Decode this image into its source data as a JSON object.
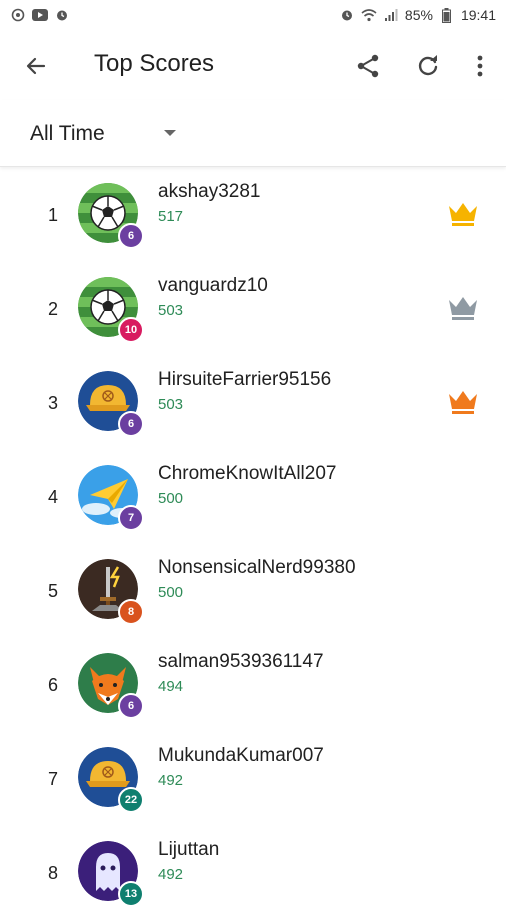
{
  "status_bar": {
    "battery": "85%",
    "time": "19:41",
    "left_icons": [
      "camera-icon",
      "youtube-icon",
      "alarm-icon"
    ],
    "right_icons": [
      "alarm-icon",
      "wifi-icon",
      "signal-icon",
      "battery-icon"
    ]
  },
  "app_bar": {
    "title": "Top Scores",
    "actions": [
      "share-icon",
      "refresh-icon",
      "more-vert-icon"
    ]
  },
  "filter": {
    "selected": "All Time"
  },
  "colors": {
    "score_green": "#2e8b57",
    "gold": "#f6b300",
    "silver": "#8f9aa3",
    "bronze": "#f07a1d",
    "purple": "#6b3fa0",
    "magenta": "#d81b60",
    "orange": "#d9531e",
    "teal": "#0f7f6f"
  },
  "leaderboard": [
    {
      "rank": "1",
      "name": "akshay3281",
      "score": "517",
      "badge": "6",
      "avatar": "soccer-ball-avatar",
      "crown": "gold-crown-icon"
    },
    {
      "rank": "2",
      "name": "vanguardz10",
      "score": "503",
      "badge": "10",
      "avatar": "soccer-ball-avatar",
      "crown": "silver-crown-icon"
    },
    {
      "rank": "3",
      "name": "HirsuiteFarrier95156",
      "score": "503",
      "badge": "6",
      "avatar": "baseball-cap-avatar",
      "crown": "bronze-crown-icon"
    },
    {
      "rank": "4",
      "name": "ChromeKnowItAll207",
      "score": "500",
      "badge": "7",
      "avatar": "paper-plane-avatar"
    },
    {
      "rank": "5",
      "name": "NonsensicalNerd99380",
      "score": "500",
      "badge": "8",
      "avatar": "sword-avatar"
    },
    {
      "rank": "6",
      "name": "salman9539361147",
      "score": "494",
      "badge": "6",
      "avatar": "fox-avatar"
    },
    {
      "rank": "7",
      "name": "MukundaKumar007",
      "score": "492",
      "badge": "22",
      "avatar": "baseball-cap-avatar"
    },
    {
      "rank": "8",
      "name": "Lijuttan",
      "score": "492",
      "badge": "13",
      "avatar": "ghost-avatar"
    }
  ]
}
